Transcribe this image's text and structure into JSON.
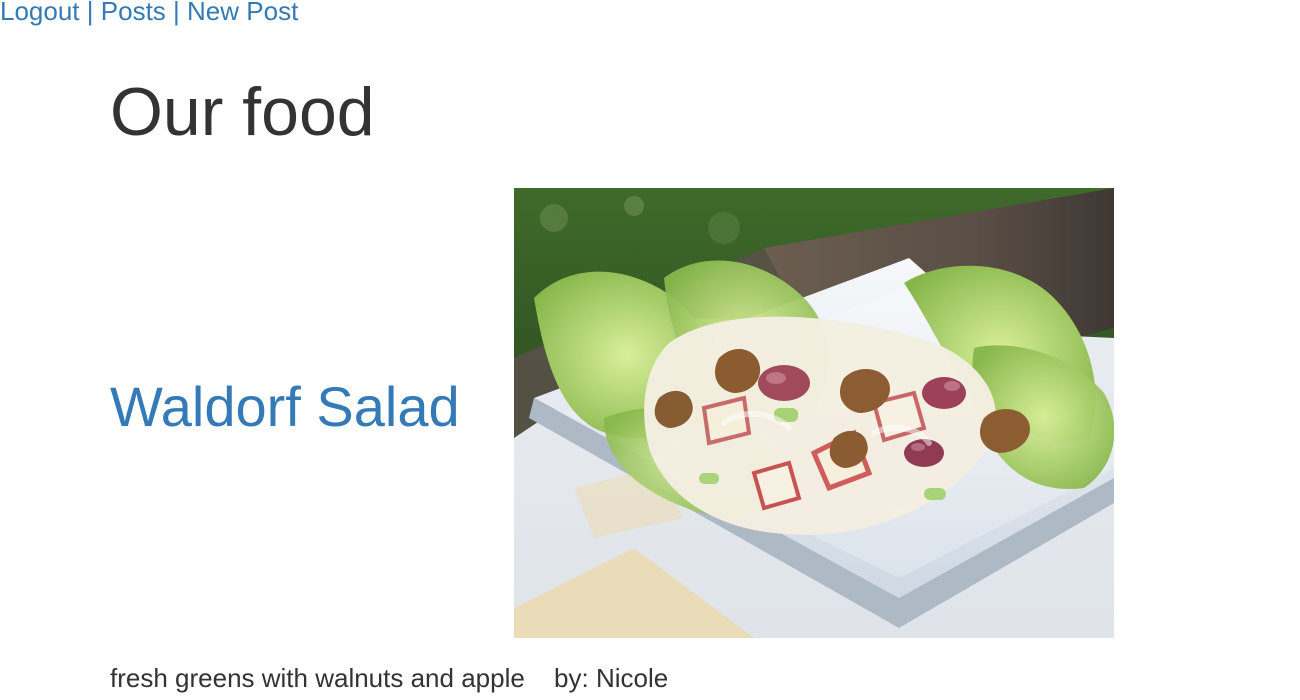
{
  "nav": {
    "logout": "Logout",
    "separator": "|",
    "posts": "Posts",
    "new_post": "New Post",
    "link_color": "#337ab7"
  },
  "page": {
    "title": "Our food"
  },
  "post": {
    "title": "Waldorf Salad",
    "image": "waldorf-salad-photo",
    "description": "fresh greens with walnuts and apple",
    "author_line": "by: Nicole"
  }
}
